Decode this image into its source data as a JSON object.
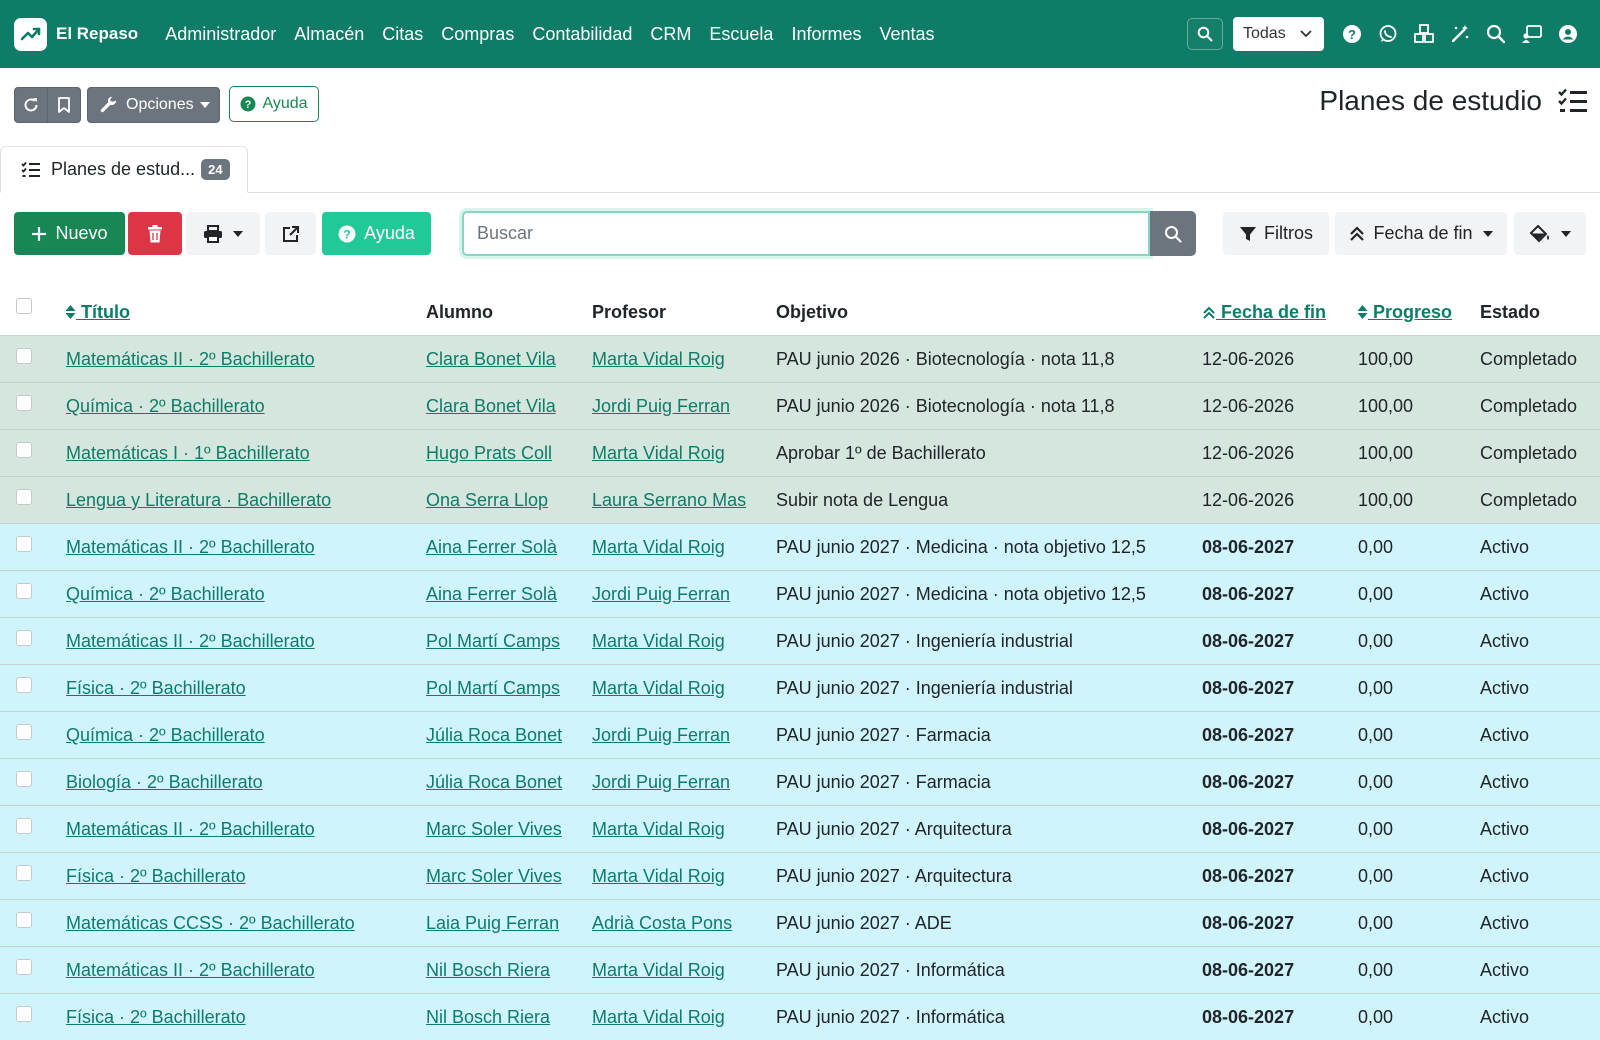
{
  "app": {
    "brand": "El Repaso",
    "nav": [
      "Administrador",
      "Almacén",
      "Citas",
      "Compras",
      "Contabilidad",
      "CRM",
      "Escuela",
      "Informes",
      "Ventas"
    ],
    "company_select": "Todas"
  },
  "toolbar": {
    "options_label": "Opciones",
    "help_label": "Ayuda",
    "page_title": "Planes de estudio"
  },
  "tab": {
    "label": "Planes de estud...",
    "count": "24"
  },
  "actions": {
    "new_label": "Nuevo",
    "help_label": "Ayuda",
    "search_placeholder": "Buscar",
    "filters_label": "Filtros",
    "order_label": "Fecha de fin"
  },
  "table": {
    "headers": {
      "title": "Título",
      "student": "Alumno",
      "teacher": "Profesor",
      "goal": "Objetivo",
      "end_date": "Fecha de fin",
      "progress": "Progreso",
      "status": "Estado"
    },
    "rows": [
      {
        "title": "Matemáticas II · 2º Bachillerato",
        "student": "Clara Bonet Vila",
        "teacher": "Marta Vidal Roig",
        "goal": "PAU junio 2026 · Biotecnología · nota 11,8",
        "end_date": "12-06-2026",
        "progress": "100,00",
        "status": "Completado",
        "state": "done"
      },
      {
        "title": "Química · 2º Bachillerato",
        "student": "Clara Bonet Vila",
        "teacher": "Jordi Puig Ferran",
        "goal": "PAU junio 2026 · Biotecnología · nota 11,8",
        "end_date": "12-06-2026",
        "progress": "100,00",
        "status": "Completado",
        "state": "done"
      },
      {
        "title": "Matemáticas I · 1º Bachillerato",
        "student": "Hugo Prats Coll",
        "teacher": "Marta Vidal Roig",
        "goal": "Aprobar 1º de Bachillerato",
        "end_date": "12-06-2026",
        "progress": "100,00",
        "status": "Completado",
        "state": "done"
      },
      {
        "title": "Lengua y Literatura · Bachillerato",
        "student": "Ona Serra Llop",
        "teacher": "Laura Serrano Mas",
        "goal": "Subir nota de Lengua",
        "end_date": "12-06-2026",
        "progress": "100,00",
        "status": "Completado",
        "state": "done"
      },
      {
        "title": "Matemáticas II · 2º Bachillerato",
        "student": "Aina Ferrer Solà",
        "teacher": "Marta Vidal Roig",
        "goal": "PAU junio 2027 · Medicina · nota objetivo 12,5",
        "end_date": "08-06-2027",
        "progress": "0,00",
        "status": "Activo",
        "state": "active"
      },
      {
        "title": "Química · 2º Bachillerato",
        "student": "Aina Ferrer Solà",
        "teacher": "Jordi Puig Ferran",
        "goal": "PAU junio 2027 · Medicina · nota objetivo 12,5",
        "end_date": "08-06-2027",
        "progress": "0,00",
        "status": "Activo",
        "state": "active"
      },
      {
        "title": "Matemáticas II · 2º Bachillerato",
        "student": "Pol Martí Camps",
        "teacher": "Marta Vidal Roig",
        "goal": "PAU junio 2027 · Ingeniería industrial",
        "end_date": "08-06-2027",
        "progress": "0,00",
        "status": "Activo",
        "state": "active"
      },
      {
        "title": "Física · 2º Bachillerato",
        "student": "Pol Martí Camps",
        "teacher": "Marta Vidal Roig",
        "goal": "PAU junio 2027 · Ingeniería industrial",
        "end_date": "08-06-2027",
        "progress": "0,00",
        "status": "Activo",
        "state": "active"
      },
      {
        "title": "Química · 2º Bachillerato",
        "student": "Júlia Roca Bonet",
        "teacher": "Jordi Puig Ferran",
        "goal": "PAU junio 2027 · Farmacia",
        "end_date": "08-06-2027",
        "progress": "0,00",
        "status": "Activo",
        "state": "active"
      },
      {
        "title": "Biología · 2º Bachillerato",
        "student": "Júlia Roca Bonet",
        "teacher": "Jordi Puig Ferran",
        "goal": "PAU junio 2027 · Farmacia",
        "end_date": "08-06-2027",
        "progress": "0,00",
        "status": "Activo",
        "state": "active"
      },
      {
        "title": "Matemáticas II · 2º Bachillerato",
        "student": "Marc Soler Vives",
        "teacher": "Marta Vidal Roig",
        "goal": "PAU junio 2027 · Arquitectura",
        "end_date": "08-06-2027",
        "progress": "0,00",
        "status": "Activo",
        "state": "active"
      },
      {
        "title": "Física · 2º Bachillerato",
        "student": "Marc Soler Vives",
        "teacher": "Marta Vidal Roig",
        "goal": "PAU junio 2027 · Arquitectura",
        "end_date": "08-06-2027",
        "progress": "0,00",
        "status": "Activo",
        "state": "active"
      },
      {
        "title": "Matemáticas CCSS · 2º Bachillerato",
        "student": "Laia Puig Ferran",
        "teacher": "Adrià Costa Pons",
        "goal": "PAU junio 2027 · ADE",
        "end_date": "08-06-2027",
        "progress": "0,00",
        "status": "Activo",
        "state": "active"
      },
      {
        "title": "Matemáticas II · 2º Bachillerato",
        "student": "Nil Bosch Riera",
        "teacher": "Marta Vidal Roig",
        "goal": "PAU junio 2027 · Informática",
        "end_date": "08-06-2027",
        "progress": "0,00",
        "status": "Activo",
        "state": "active"
      },
      {
        "title": "Física · 2º Bachillerato",
        "student": "Nil Bosch Riera",
        "teacher": "Marta Vidal Roig",
        "goal": "PAU junio 2027 · Informática",
        "end_date": "08-06-2027",
        "progress": "0,00",
        "status": "Activo",
        "state": "active"
      }
    ]
  },
  "colors": {
    "navbar": "#0e7c66",
    "completed_row": "#d4e6de",
    "active_row": "#cff4fc",
    "link": "#0e7c66",
    "new_button": "#198754",
    "delete_button": "#dc3545",
    "help_button": "#20c997"
  }
}
